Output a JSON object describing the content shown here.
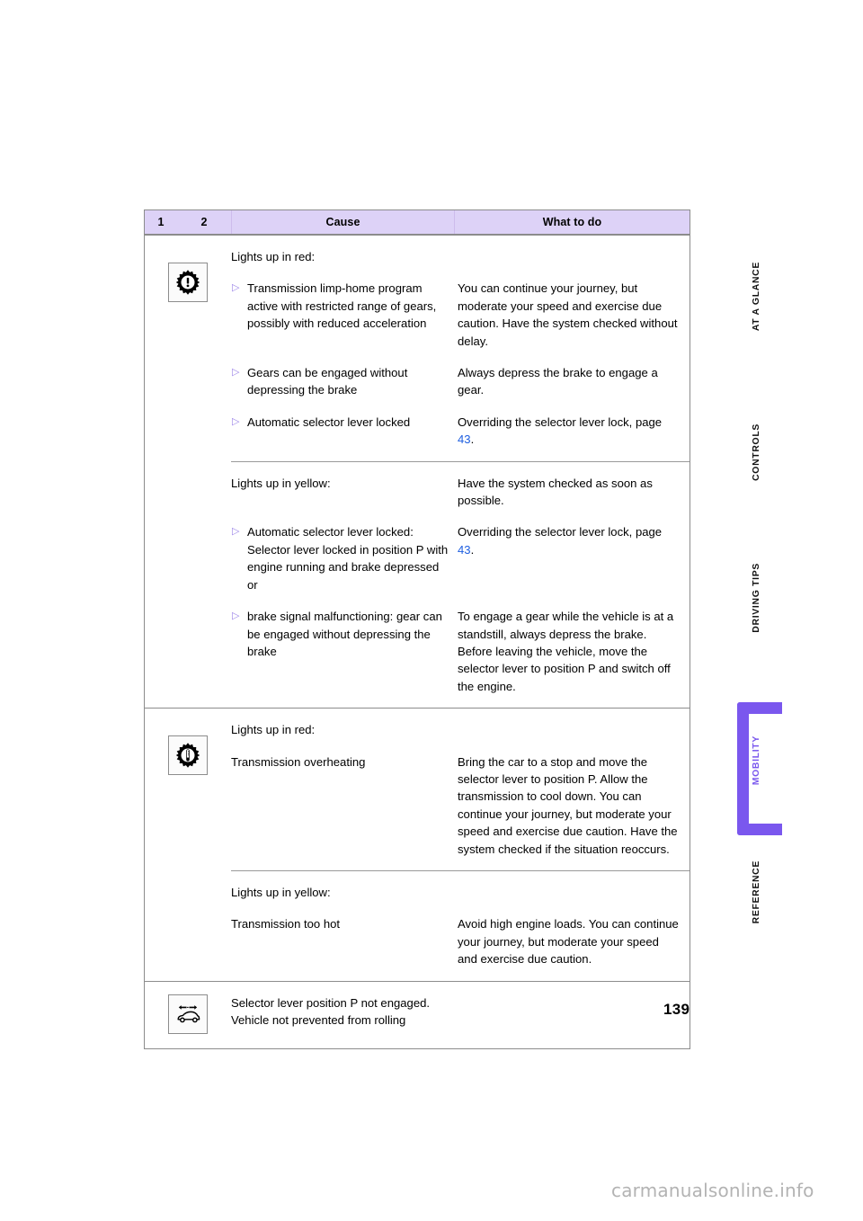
{
  "table": {
    "headers": {
      "col1": "1",
      "col2": "2",
      "col3": "Cause",
      "col4": "What to do"
    },
    "sections": [
      {
        "icon_name": "gear-warning-icon",
        "rows": [
          {
            "heading": "Lights up in red:",
            "heading_what": "",
            "bullets": [
              {
                "cause": "Transmission limp-home program active with restricted range of gears, possibly with reduced acceleration",
                "what": "You can continue your journey, but moderate your speed and exercise due caution. Have the system checked without delay."
              },
              {
                "cause": "Gears can be engaged without depressing the brake",
                "what": "Always depress the brake to engage a gear."
              },
              {
                "cause": "Automatic selector lever locked",
                "what_pre": "Overriding the selector lever lock, page ",
                "what_ref": "43",
                "what_post": "."
              }
            ]
          },
          {
            "heading": "Lights up in yellow:",
            "heading_what": "Have the system checked as soon as possible.",
            "bullets": [
              {
                "cause": "Automatic selector lever locked: Selector lever locked in position P with engine running and brake depressed or",
                "what_pre": "Overriding the selector lever lock, page ",
                "what_ref": "43",
                "what_post": "."
              },
              {
                "cause": "brake signal malfunctioning: gear can be engaged without depressing the brake",
                "what": "To engage a gear while the vehicle is at a standstill, always depress the brake. Before leaving the vehicle, move the selector lever to position P and switch off the engine."
              }
            ]
          }
        ]
      },
      {
        "icon_name": "gear-temperature-icon",
        "rows": [
          {
            "heading": "Lights up in red:",
            "heading_what": "",
            "plain": {
              "cause": "Transmission overheating",
              "what": "Bring the car to a stop and move the selector lever to position P. Allow the transmission to cool down. You can continue your journey, but moderate your speed and exercise due caution. Have the system checked if the situation reoccurs."
            }
          },
          {
            "heading": "Lights up in yellow:",
            "heading_what": "",
            "plain": {
              "cause": "Transmission too hot",
              "what": "Avoid high engine loads. You can continue your journey, but moderate your speed and exercise due caution."
            }
          }
        ]
      },
      {
        "icon_name": "car-rolling-icon",
        "rows": [
          {
            "simple_line1": "Selector lever position P not engaged.",
            "simple_line2": "Vehicle not prevented from rolling"
          }
        ]
      }
    ]
  },
  "sidenav": {
    "items": [
      {
        "label": "AT A GLANCE",
        "active": false
      },
      {
        "label": "CONTROLS",
        "active": false
      },
      {
        "label": "DRIVING TIPS",
        "active": false
      },
      {
        "label": "MOBILITY",
        "active": true
      },
      {
        "label": "REFERENCE",
        "active": false
      }
    ]
  },
  "page_number": "139",
  "watermark": "carmanualsonline.info",
  "colors": {
    "header_bg": "#ddd2f7",
    "accent": "#7a57ee",
    "link": "#1f5fe0",
    "bullet": "#9d86e8"
  }
}
